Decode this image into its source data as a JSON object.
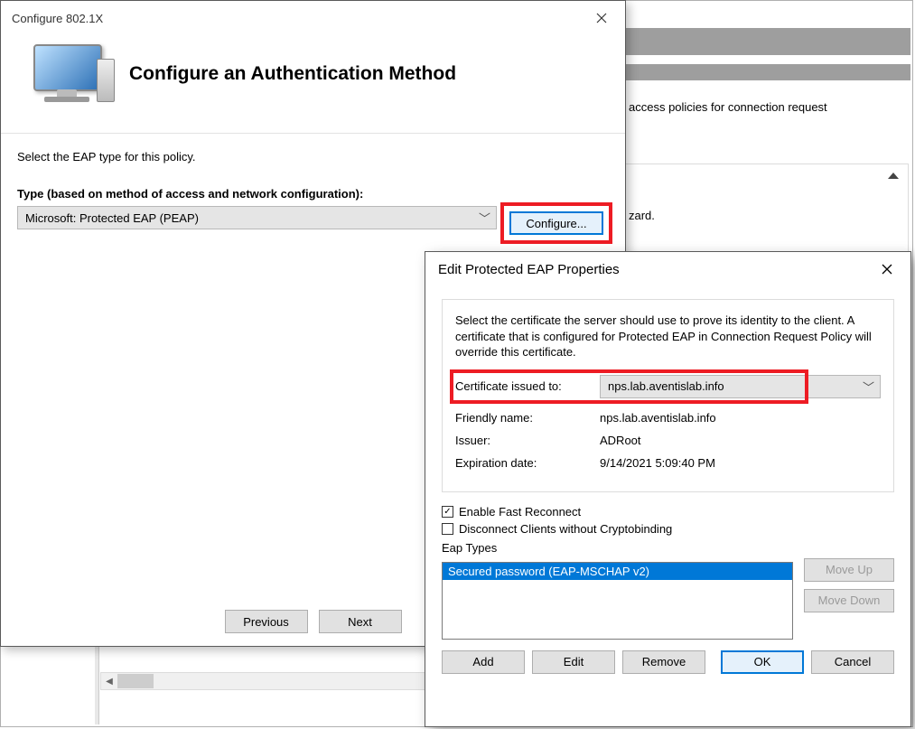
{
  "background": {
    "desc_fragment": "access policies for connection request",
    "zard_fragment": "zard."
  },
  "dlg1": {
    "title": "Configure 802.1X",
    "heading": "Configure an Authentication Method",
    "instruction": "Select the EAP type for this policy.",
    "type_label": "Type (based on method of access and network configuration):",
    "eap_selected": "Microsoft: Protected EAP (PEAP)",
    "configure_btn": "Configure...",
    "previous_btn": "Previous",
    "next_btn": "Next"
  },
  "dlg2": {
    "title": "Edit Protected EAP Properties",
    "desc": "Select the certificate the server should use to prove its identity to the client. A certificate that is configured for Protected EAP in Connection Request Policy will override this certificate.",
    "cert_issued_label": "Certificate issued to:",
    "cert_issued_value": "nps.lab.aventislab.info",
    "friendly_label": "Friendly name:",
    "friendly_value": "nps.lab.aventislab.info",
    "issuer_label": "Issuer:",
    "issuer_value": "ADRoot",
    "expiry_label": "Expiration date:",
    "expiry_value": "9/14/2021 5:09:40 PM",
    "fast_reconnect": "Enable Fast Reconnect",
    "cryptobinding": "Disconnect Clients without Cryptobinding",
    "eap_types_label": "Eap Types",
    "eap_type_item": "Secured password (EAP-MSCHAP v2)",
    "move_up": "Move Up",
    "move_down": "Move Down",
    "add": "Add",
    "edit": "Edit",
    "remove": "Remove",
    "ok": "OK",
    "cancel": "Cancel"
  }
}
